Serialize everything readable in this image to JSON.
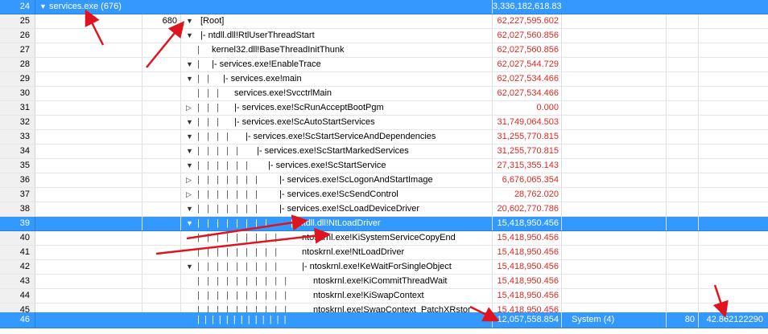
{
  "header": {
    "row_num": "24",
    "toggle": "▼",
    "process": "services.exe (676)",
    "weight": "3,336,182,618.830"
  },
  "rows": [
    {
      "num": "25",
      "id": "680",
      "toggle": "▼",
      "depth": 0,
      "prefix": "",
      "fn": "[Root]",
      "weight": "62,227,595.602",
      "selected": false
    },
    {
      "num": "26",
      "id": "",
      "toggle": "▼",
      "depth": 0,
      "prefix": "|- ",
      "fn": "ntdll.dll!RtlUserThreadStart",
      "weight": "62,027,560.856",
      "selected": false
    },
    {
      "num": "27",
      "id": "",
      "toggle": "",
      "depth": 1,
      "prefix": "",
      "fn": "kernel32.dll!BaseThreadInitThunk",
      "weight": "62,027,560.856",
      "selected": false
    },
    {
      "num": "28",
      "id": "",
      "toggle": "▼",
      "depth": 1,
      "prefix": "|- ",
      "fn": "services.exe!EnableTrace",
      "weight": "62,027,544.729",
      "selected": false
    },
    {
      "num": "29",
      "id": "",
      "toggle": "▼",
      "depth": 2,
      "prefix": "|- ",
      "fn": "services.exe!main",
      "weight": "62,027,534.466",
      "selected": false
    },
    {
      "num": "30",
      "id": "",
      "toggle": "",
      "depth": 3,
      "prefix": "",
      "fn": "services.exe!SvcctrlMain",
      "weight": "62,027,534.466",
      "selected": false
    },
    {
      "num": "31",
      "id": "",
      "toggle": "▷",
      "depth": 3,
      "prefix": "|- ",
      "fn": "services.exe!ScRunAcceptBootPgm",
      "weight": "0.000",
      "selected": false
    },
    {
      "num": "32",
      "id": "",
      "toggle": "▼",
      "depth": 3,
      "prefix": "|- ",
      "fn": "services.exe!ScAutoStartServices",
      "weight": "31,749,064.503",
      "selected": false
    },
    {
      "num": "33",
      "id": "",
      "toggle": "▼",
      "depth": 4,
      "prefix": "|- ",
      "fn": "services.exe!ScStartServiceAndDependencies",
      "weight": "31,255,770.815",
      "selected": false
    },
    {
      "num": "34",
      "id": "",
      "toggle": "▼",
      "depth": 5,
      "prefix": "|- ",
      "fn": "services.exe!ScStartMarkedServices",
      "weight": "31,255,770.815",
      "selected": false
    },
    {
      "num": "35",
      "id": "",
      "toggle": "▼",
      "depth": 6,
      "prefix": "|- ",
      "fn": "services.exe!ScStartService",
      "weight": "27,315,355.143",
      "selected": false
    },
    {
      "num": "36",
      "id": "",
      "toggle": "▷",
      "depth": 7,
      "prefix": "|- ",
      "fn": "services.exe!ScLogonAndStartImage",
      "weight": "6,676,065.354",
      "selected": false
    },
    {
      "num": "37",
      "id": "",
      "toggle": "▷",
      "depth": 7,
      "prefix": "|- ",
      "fn": "services.exe!ScSendControl",
      "weight": "28,762.020",
      "selected": false
    },
    {
      "num": "38",
      "id": "",
      "toggle": "▼",
      "depth": 7,
      "prefix": "|- ",
      "fn": "services.exe!ScLoadDeviceDriver",
      "weight": "20,602,770.786",
      "selected": false
    },
    {
      "num": "39",
      "id": "",
      "toggle": "▼",
      "depth": 8,
      "prefix": "|- ",
      "fn": "ntdll.dll!NtLoadDriver",
      "weight": "15,418,950.456",
      "selected": true
    },
    {
      "num": "40",
      "id": "",
      "toggle": "",
      "depth": 9,
      "prefix": "",
      "fn": "ntoskrnl.exe!KiSystemServiceCopyEnd",
      "weight": "15,418,950.456",
      "selected": false
    },
    {
      "num": "41",
      "id": "",
      "toggle": "",
      "depth": 9,
      "prefix": "",
      "fn": "ntoskrnl.exe!NtLoadDriver",
      "weight": "15,418,950.456",
      "selected": false
    },
    {
      "num": "42",
      "id": "",
      "toggle": "▼",
      "depth": 9,
      "prefix": "|- ",
      "fn": "ntoskrnl.exe!KeWaitForSingleObject",
      "weight": "15,418,950.456",
      "selected": false
    },
    {
      "num": "43",
      "id": "",
      "toggle": "",
      "depth": 10,
      "prefix": "",
      "fn": "ntoskrnl.exe!KiCommitThreadWait",
      "weight": "15,418,950.456",
      "selected": false
    },
    {
      "num": "44",
      "id": "",
      "toggle": "",
      "depth": 10,
      "prefix": "",
      "fn": "ntoskrnl.exe!KiSwapContext",
      "weight": "15,418,950.456",
      "selected": false
    },
    {
      "num": "45",
      "id": "",
      "toggle": "",
      "depth": 10,
      "prefix": "",
      "fn": "ntoskrnl.exe!SwapContext_PatchXRstor",
      "weight": "15,418,950.456",
      "selected": false
    }
  ],
  "footer": {
    "row_num": "46",
    "weight": "12,057,558.854",
    "process": "System (4)",
    "id": "80",
    "value": "42.862122290"
  },
  "colors": {
    "selection": "#3399ff",
    "weight_text": "#e1281e",
    "annotation_arrow": "#e0141e"
  },
  "annotations": {
    "arrow_count": 6
  }
}
